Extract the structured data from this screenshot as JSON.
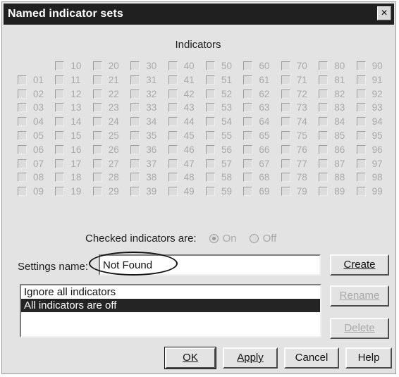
{
  "window": {
    "title": "Named indicator sets",
    "close_label": "×"
  },
  "indicators": {
    "heading": "Indicators",
    "column_headers": [
      "",
      "10",
      "20",
      "30",
      "40",
      "50",
      "60",
      "70",
      "80",
      "90"
    ],
    "rows": [
      [
        "01",
        "11",
        "21",
        "31",
        "41",
        "51",
        "61",
        "71",
        "81",
        "91"
      ],
      [
        "02",
        "12",
        "22",
        "32",
        "42",
        "52",
        "62",
        "72",
        "82",
        "92"
      ],
      [
        "03",
        "13",
        "23",
        "33",
        "43",
        "53",
        "63",
        "73",
        "83",
        "93"
      ],
      [
        "04",
        "14",
        "24",
        "34",
        "44",
        "54",
        "64",
        "74",
        "84",
        "94"
      ],
      [
        "05",
        "15",
        "25",
        "35",
        "45",
        "55",
        "65",
        "75",
        "85",
        "95"
      ],
      [
        "06",
        "16",
        "26",
        "36",
        "46",
        "56",
        "66",
        "76",
        "86",
        "96"
      ],
      [
        "07",
        "17",
        "27",
        "37",
        "47",
        "57",
        "67",
        "77",
        "87",
        "97"
      ],
      [
        "08",
        "18",
        "28",
        "38",
        "48",
        "58",
        "68",
        "78",
        "88",
        "98"
      ],
      [
        "09",
        "19",
        "29",
        "39",
        "49",
        "59",
        "69",
        "79",
        "89",
        "99"
      ]
    ]
  },
  "checked_state": {
    "label": "Checked indicators are:",
    "options": [
      {
        "label": "On",
        "selected": true
      },
      {
        "label": "Off",
        "selected": false
      }
    ]
  },
  "settings": {
    "label": "Settings name:",
    "value": "Not Found"
  },
  "list": {
    "items": [
      {
        "label": "Ignore all indicators",
        "selected": false
      },
      {
        "label": "All indicators are off",
        "selected": true
      }
    ]
  },
  "buttons": {
    "create": "Create",
    "rename": "Rename",
    "delete": "Delete",
    "ok": "OK",
    "apply": "Apply",
    "cancel": "Cancel",
    "help": "Help"
  }
}
